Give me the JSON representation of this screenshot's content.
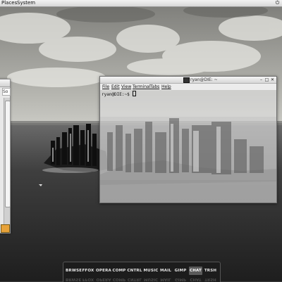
{
  "top_panel": {
    "places_label": "Places",
    "system_label": "System"
  },
  "terminal": {
    "title": "ryan@DIE: ~",
    "menu": {
      "file": "File",
      "edit": "Edit",
      "view": "View",
      "terminal": "Terminal",
      "tabs": "Tabs",
      "help": "Help"
    },
    "prompt": "ryan@DIE:~$"
  },
  "left_window": {
    "tab_stub": "So"
  },
  "dock": {
    "items": [
      {
        "label": "BRWSE"
      },
      {
        "label": "FFOX"
      },
      {
        "label": "OPERA"
      },
      {
        "label": "COMP"
      },
      {
        "label": "CNTRL"
      },
      {
        "label": "MUSIC"
      },
      {
        "label": "MAIL"
      },
      {
        "label": "GIMP"
      },
      {
        "label": "CHAT",
        "active": true
      },
      {
        "label": "TRSH"
      }
    ]
  },
  "colors": {
    "dock_bg": "#1c1c1c",
    "active_item": "#5a5a5a",
    "panel_bg": "#e4e4e4"
  }
}
